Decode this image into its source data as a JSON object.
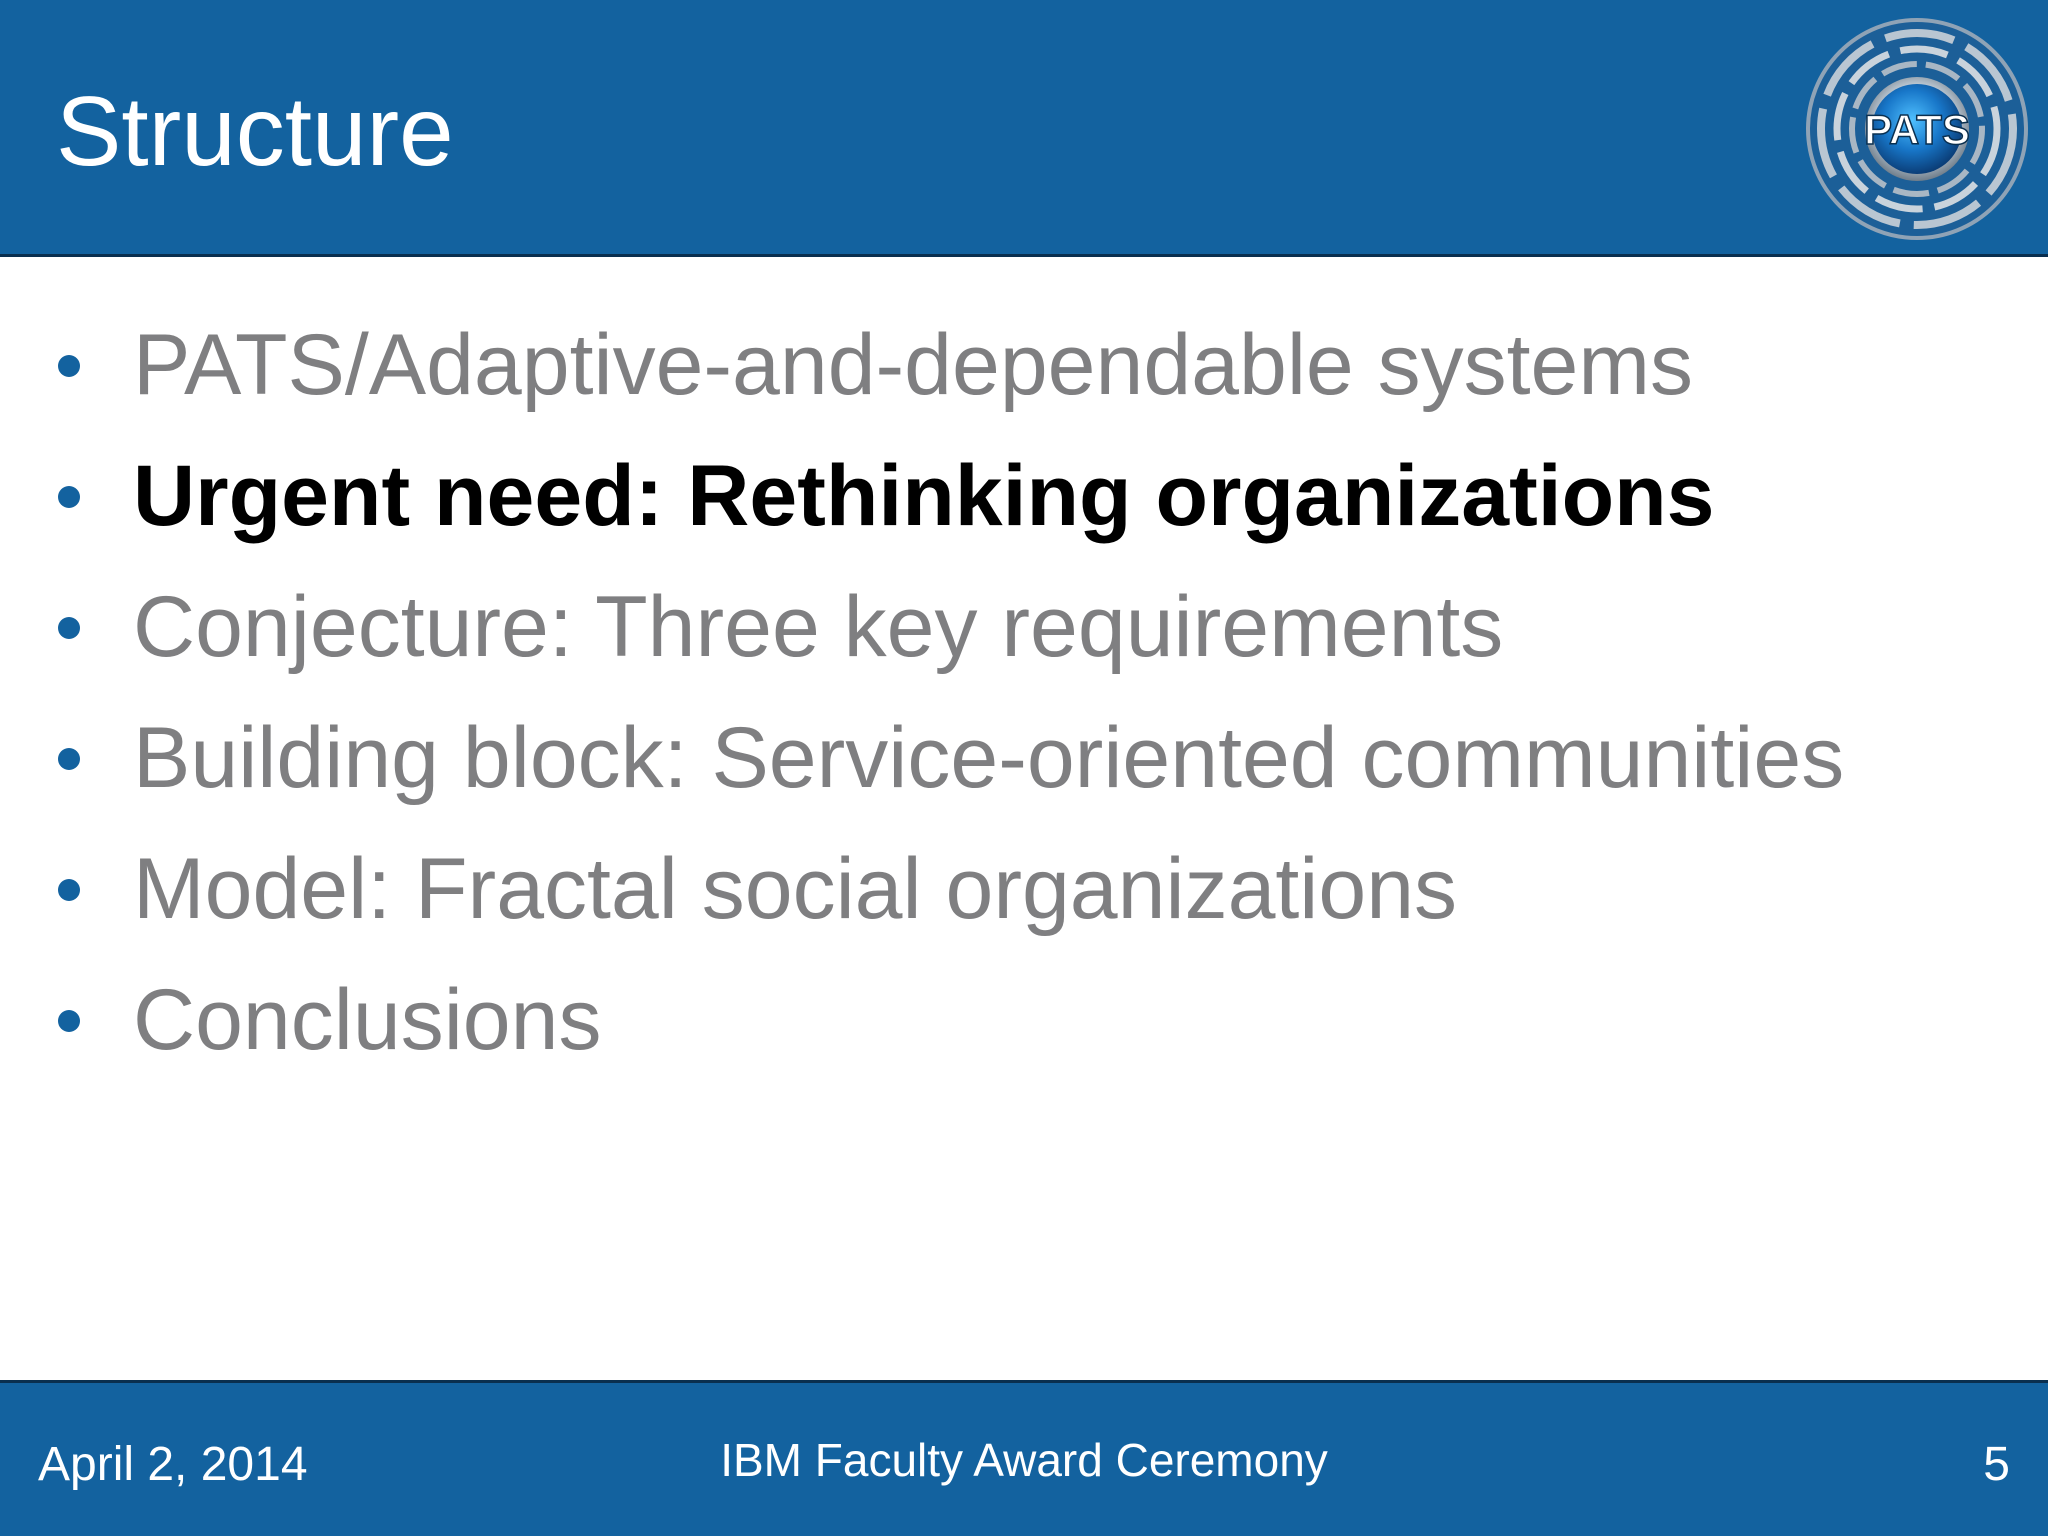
{
  "slide": {
    "title": "Structure",
    "logo_text": "PATS",
    "bullets": [
      {
        "text": "PATS/Adaptive-and-dependable systems",
        "active": false
      },
      {
        "text": "Urgent need: Rethinking organizations",
        "active": true
      },
      {
        "text": "Conjecture: Three key requirements",
        "active": false
      },
      {
        "text": "Building block: Service-oriented communities",
        "active": false
      },
      {
        "text": "Model: Fractal social organizations",
        "active": false
      },
      {
        "text": "Conclusions",
        "active": false
      }
    ]
  },
  "footer": {
    "date": "April 2, 2014",
    "event": "IBM Faculty Award Ceremony",
    "page_number": "5"
  },
  "colors": {
    "header_blue": "#13629f",
    "inactive_text": "#7f7f81",
    "active_text": "#000000"
  }
}
